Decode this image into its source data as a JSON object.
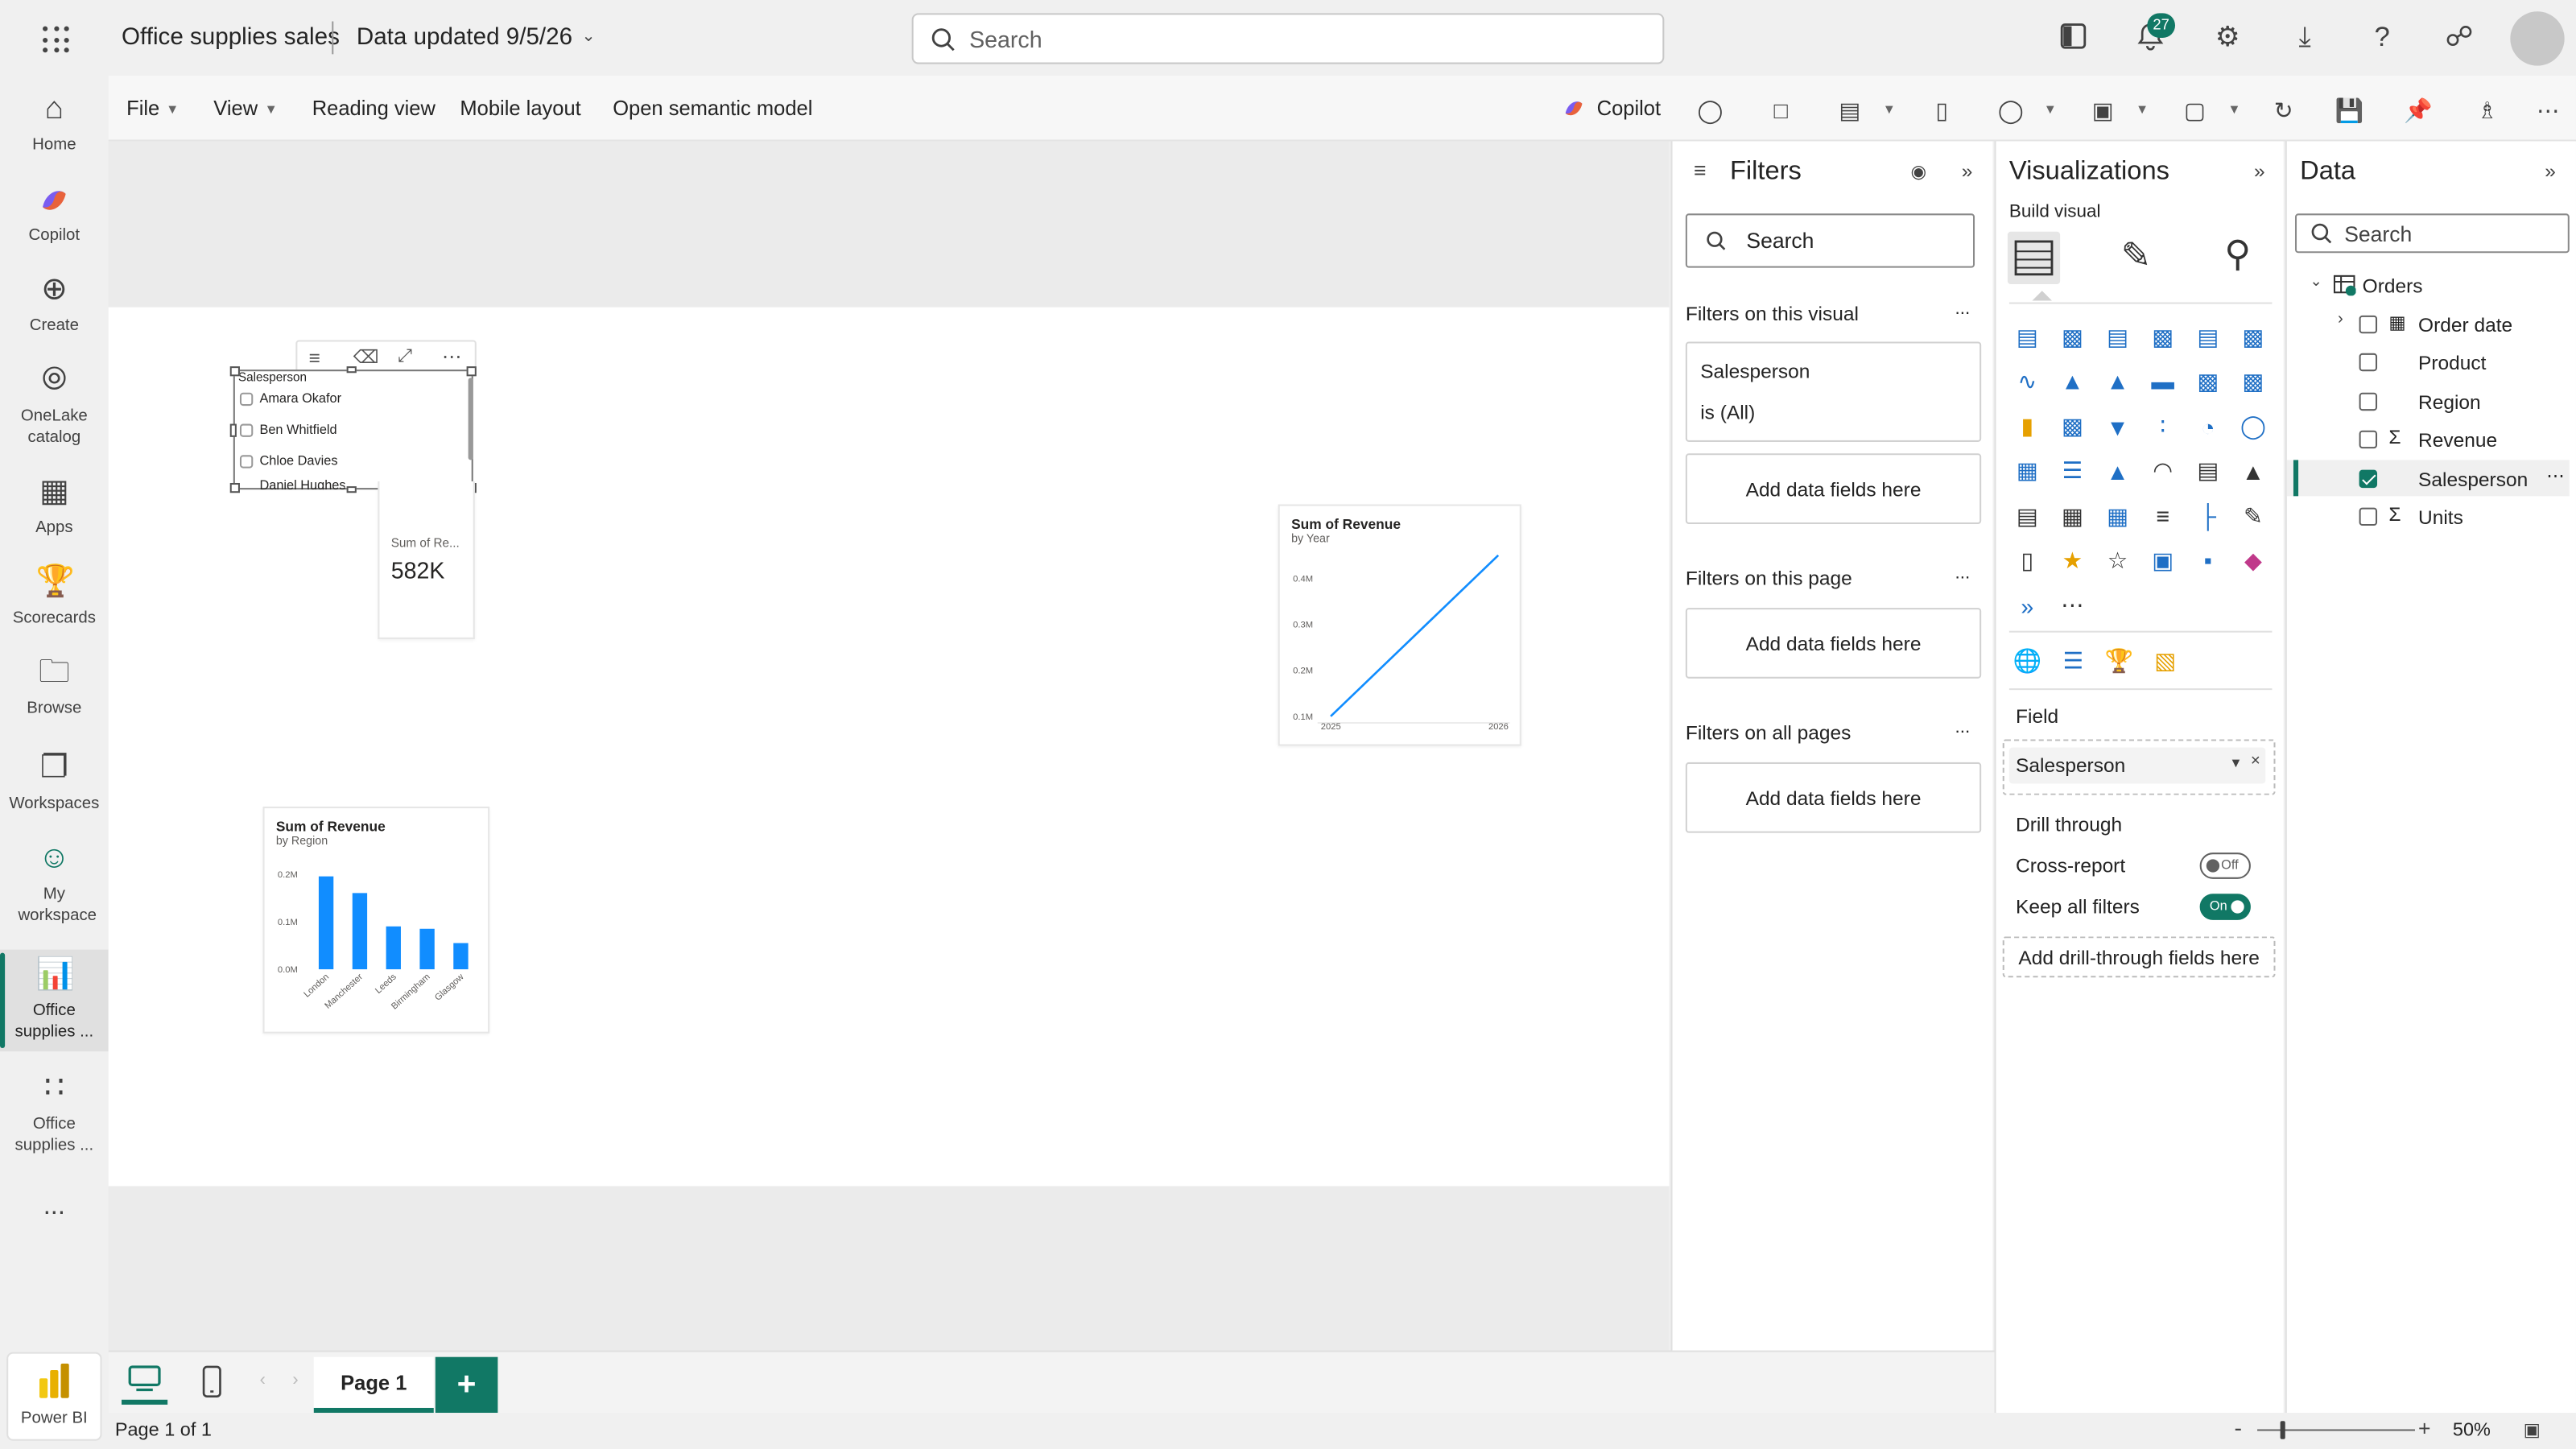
{
  "topbar": {
    "report_name": "Office supplies sales",
    "data_updated": "Data updated 9/5/26",
    "search_placeholder": "Search",
    "notifications_count": "27"
  },
  "rail": {
    "items": [
      {
        "label": "Home",
        "icon": "home-icon"
      },
      {
        "label": "Copilot",
        "icon": "copilot-icon"
      },
      {
        "label": "Create",
        "icon": "plus-circle-icon"
      },
      {
        "label": "OneLake catalog",
        "icon": "onelake-icon"
      },
      {
        "label": "Apps",
        "icon": "apps-icon"
      },
      {
        "label": "Scorecards",
        "icon": "trophy-icon"
      },
      {
        "label": "Browse",
        "icon": "folder-icon"
      },
      {
        "label": "Workspaces",
        "icon": "workspaces-icon"
      },
      {
        "label": "My workspace",
        "icon": "person-icon"
      },
      {
        "label": "Office supplies ...",
        "icon": "report-icon"
      },
      {
        "label": "Office supplies ...",
        "icon": "semantic-model-icon"
      }
    ],
    "more": "...",
    "product": "Power BI"
  },
  "cmdbar": {
    "file": "File",
    "view": "View",
    "reading_view": "Reading view",
    "mobile_layout": "Mobile layout",
    "open_model": "Open semantic model",
    "copilot": "Copilot"
  },
  "slicer": {
    "title": "Salesperson",
    "items": [
      "Amara Okafor",
      "Ben Whitfield",
      "Chloe Davies",
      "Daniel Hughes"
    ]
  },
  "card": {
    "label": "Sum of Re...",
    "value": "582K"
  },
  "line_chart_meta": {
    "title": "Sum of Revenue",
    "subtitle": "by Year"
  },
  "bar_chart_meta": {
    "title": "Sum of Revenue",
    "subtitle": "by Region"
  },
  "chart_data": [
    {
      "type": "line",
      "title": "Sum of Revenue",
      "subtitle": "by Year",
      "x": [
        "2025",
        "2026"
      ],
      "series": [
        {
          "values": [
            0.1,
            0.45
          ]
        }
      ],
      "y_ticks": [
        "0.1M",
        "0.2M",
        "0.3M",
        "0.4M"
      ],
      "ylim": [
        0.1,
        0.4
      ],
      "color": "#118dff"
    },
    {
      "type": "bar",
      "title": "Sum of Revenue",
      "subtitle": "by Region",
      "categories": [
        "London",
        "Manchester",
        "Leeds",
        "Birmingham",
        "Glasgow"
      ],
      "values": [
        0.195,
        0.16,
        0.09,
        0.085,
        0.055
      ],
      "y_ticks": [
        "0.0M",
        "0.1M",
        "0.2M"
      ],
      "ylim": [
        0,
        0.2
      ],
      "color": "#118dff"
    }
  ],
  "filters": {
    "title": "Filters",
    "search_placeholder": "Search",
    "on_visual": "Filters on this visual",
    "visual_field": "Salesperson",
    "visual_field_state": "is (All)",
    "add_fields": "Add data fields here",
    "on_page": "Filters on this page",
    "on_all_pages": "Filters on all pages",
    "more": "..."
  },
  "viz": {
    "title": "Visualizations",
    "build_visual": "Build visual",
    "field_label": "Field",
    "field_value": "Salesperson",
    "drill_through": "Drill through",
    "cross_report": "Cross-report",
    "cross_report_state": "Off",
    "keep_filters": "Keep all filters",
    "keep_filters_state": "On",
    "add_drill": "Add drill-through fields here",
    "more_visuals": "..."
  },
  "data_pane": {
    "title": "Data",
    "search_placeholder": "Search",
    "table": "Orders",
    "fields": [
      {
        "name": "Order date",
        "type": "date",
        "checked": false
      },
      {
        "name": "Product",
        "type": "text",
        "checked": false
      },
      {
        "name": "Region",
        "type": "text",
        "checked": false
      },
      {
        "name": "Revenue",
        "type": "sum",
        "checked": false
      },
      {
        "name": "Salesperson",
        "type": "text",
        "checked": true
      },
      {
        "name": "Units",
        "type": "sum",
        "checked": false
      }
    ]
  },
  "tabs": {
    "page_tab": "Page 1",
    "add": "+"
  },
  "status": {
    "page_info": "Page 1 of 1",
    "zoom": "50%",
    "zoom_level": 0.5
  },
  "colors": {
    "accent": "#117865",
    "chart": "#118dff"
  }
}
